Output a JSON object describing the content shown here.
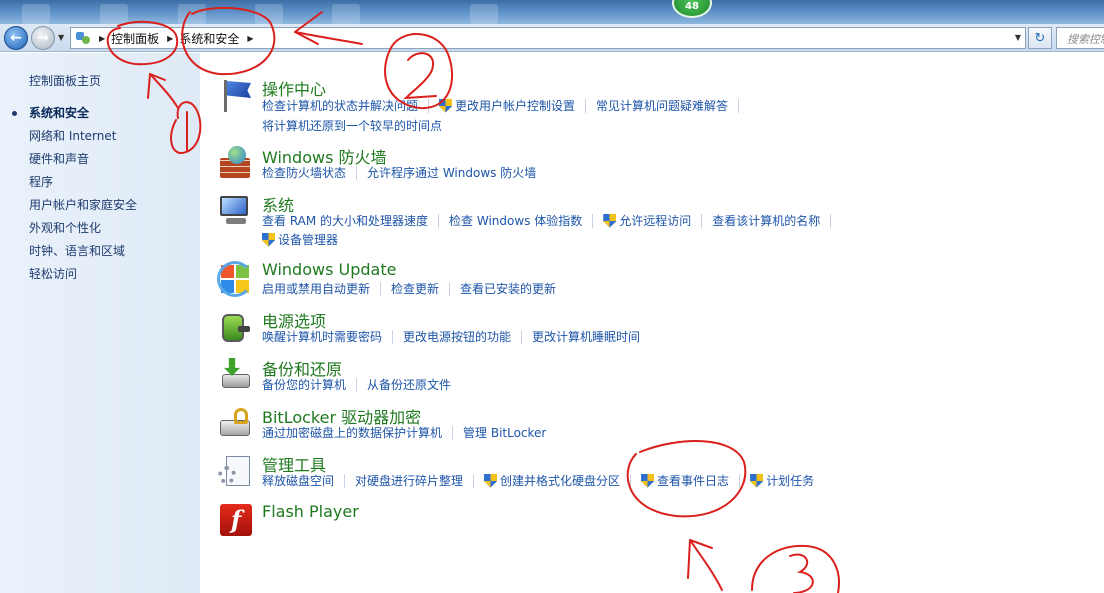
{
  "notification_badge": "48",
  "nav": {
    "breadcrumbs": [
      "控制面板",
      "系统和安全"
    ],
    "search_placeholder": "搜索控制"
  },
  "left_pane": {
    "home_link": "控制面板主页",
    "items": [
      {
        "label": "系统和安全",
        "current": true
      },
      {
        "label": "网络和 Internet"
      },
      {
        "label": "硬件和声音"
      },
      {
        "label": "程序"
      },
      {
        "label": "用户帐户和家庭安全"
      },
      {
        "label": "外观和个性化"
      },
      {
        "label": "时钟、语言和区域"
      },
      {
        "label": "轻松访问"
      }
    ]
  },
  "categories": [
    {
      "title": "操作中心",
      "icon": "flag-icon",
      "links": [
        [
          "检查计算机的状态并解决问题",
          "更改用户帐户控制设置",
          "常见计算机问题疑难解答"
        ],
        [
          "将计算机还原到一个较早的时间点"
        ]
      ]
    },
    {
      "title": "Windows 防火墙",
      "icon": "firewall-icon",
      "links": [
        [
          "检查防火墙状态",
          "允许程序通过 Windows 防火墙"
        ]
      ]
    },
    {
      "title": "系统",
      "icon": "computer-icon",
      "links": [
        [
          "查看 RAM 的大小和处理器速度",
          "检查 Windows 体验指数",
          "允许远程访问",
          "查看该计算机的名称"
        ],
        [
          "设备管理器"
        ]
      ]
    },
    {
      "title": "Windows Update",
      "icon": "windows-update-icon",
      "links": [
        [
          "启用或禁用自动更新",
          "检查更新",
          "查看已安装的更新"
        ]
      ]
    },
    {
      "title": "电源选项",
      "icon": "battery-icon",
      "links": [
        [
          "唤醒计算机时需要密码",
          "更改电源按钮的功能",
          "更改计算机睡眠时间"
        ]
      ]
    },
    {
      "title": "备份和还原",
      "icon": "backup-icon",
      "links": [
        [
          "备份您的计算机",
          "从备份还原文件"
        ]
      ]
    },
    {
      "title": "BitLocker 驱动器加密",
      "icon": "bitlocker-icon",
      "links": [
        [
          "通过加密磁盘上的数据保护计算机",
          "管理 BitLocker"
        ]
      ]
    },
    {
      "title": "管理工具",
      "icon": "admin-tools-icon",
      "links": [
        [
          "释放磁盘空间",
          "对硬盘进行碎片整理",
          "创建并格式化硬盘分区",
          "查看事件日志",
          "计划任务"
        ]
      ]
    },
    {
      "title": "Flash Player",
      "icon": "flash-icon",
      "links": []
    }
  ],
  "annotations": {
    "numbers": [
      "1",
      "2",
      "3"
    ],
    "color": "#d9201c"
  },
  "colors": {
    "category_title": "#1f7a1f",
    "link": "#1d55a8",
    "left_pane_bg": "#e5eef8"
  }
}
